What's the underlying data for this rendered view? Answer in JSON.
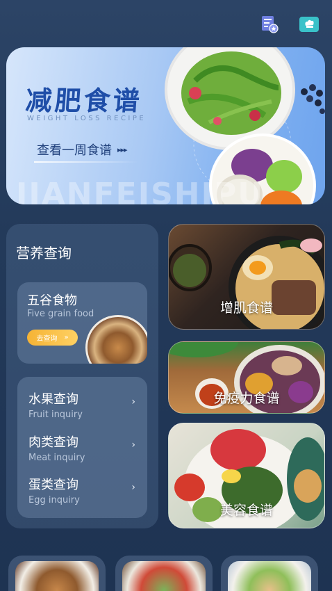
{
  "header": {
    "icons": [
      "recipe-badge-icon",
      "chef-hat-icon"
    ]
  },
  "banner": {
    "title": "减肥食谱",
    "subtitle": "WEIGHT LOSS RECIPE",
    "link_text": "查看一周食谱",
    "link_arrows": "▸▸▸",
    "watermark": "JIANFEISHIPU"
  },
  "nutrition": {
    "title": "营养查询",
    "grain": {
      "name": "五谷食物",
      "name_en": "Five grain food",
      "button_label": "去查询",
      "button_arrows": "»"
    },
    "inquiries": [
      {
        "name": "水果查询",
        "name_en": "Fruit inquiry"
      },
      {
        "name": "肉类查询",
        "name_en": "Meat inquiry"
      },
      {
        "name": "蛋类查询",
        "name_en": "Egg inquiry"
      }
    ],
    "chevron": "›"
  },
  "recipes": [
    {
      "label": "增肌食谱"
    },
    {
      "label": "免疫力食谱"
    },
    {
      "label": "美容食谱"
    }
  ],
  "colors": {
    "background": "#233a5a",
    "banner_title": "#1f4ea8",
    "button_gradient_start": "#f5b335",
    "button_gradient_end": "#ffd163"
  }
}
